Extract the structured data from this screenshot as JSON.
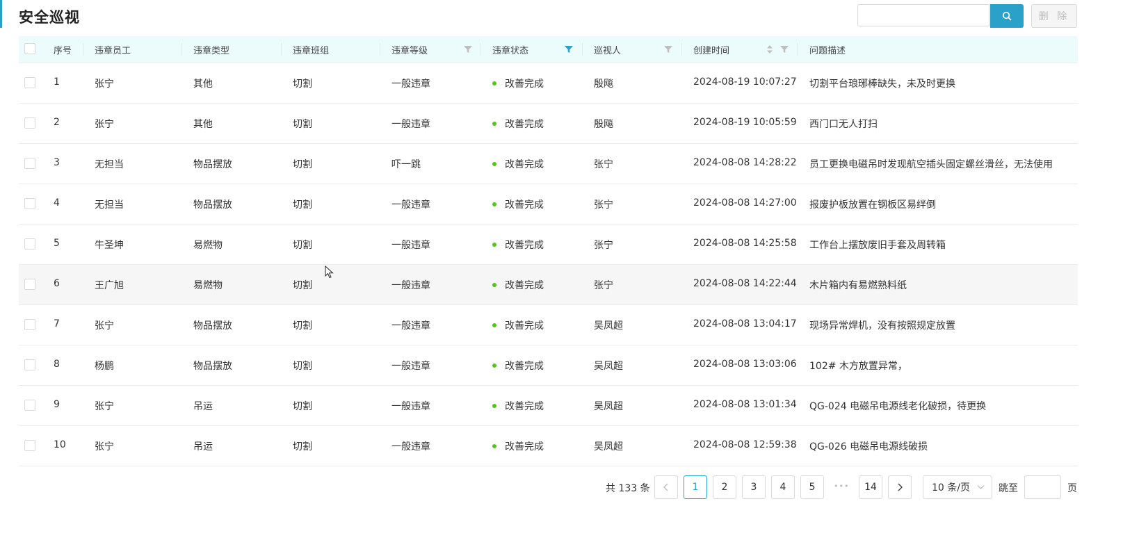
{
  "page": {
    "title": "安全巡视"
  },
  "toolbar": {
    "search_placeholder": "",
    "delete_label": "删 除"
  },
  "table": {
    "headers": {
      "index": "序号",
      "employee": "违章员工",
      "type": "违章类型",
      "team": "违章班组",
      "level": "违章等级",
      "status": "违章状态",
      "inspector": "巡视人",
      "created": "创建时间",
      "description": "问题描述"
    },
    "rows": [
      {
        "index": "1",
        "employee": "张宁",
        "type": "其他",
        "team": "切割",
        "level": "一般违章",
        "status": "改善完成",
        "inspector": "殷飚",
        "created": "2024-08-19 10:07:27",
        "description": "切割平台琅琊棒缺失，未及时更换"
      },
      {
        "index": "2",
        "employee": "张宁",
        "type": "其他",
        "team": "切割",
        "level": "一般违章",
        "status": "改善完成",
        "inspector": "殷飚",
        "created": "2024-08-19 10:05:59",
        "description": "西门口无人打扫"
      },
      {
        "index": "3",
        "employee": "无担当",
        "type": "物品摆放",
        "team": "切割",
        "level": "吓一跳",
        "status": "改善完成",
        "inspector": "张宁",
        "created": "2024-08-08 14:28:22",
        "description": "员工更换电磁吊时发现航空插头固定螺丝滑丝，无法使用"
      },
      {
        "index": "4",
        "employee": "无担当",
        "type": "物品摆放",
        "team": "切割",
        "level": "一般违章",
        "status": "改善完成",
        "inspector": "张宁",
        "created": "2024-08-08 14:27:00",
        "description": "报废护板放置在钢板区易绊倒"
      },
      {
        "index": "5",
        "employee": "牛圣坤",
        "type": "易燃物",
        "team": "切割",
        "level": "一般违章",
        "status": "改善完成",
        "inspector": "张宁",
        "created": "2024-08-08 14:25:58",
        "description": "工作台上摆放废旧手套及周转箱"
      },
      {
        "index": "6",
        "employee": "王广旭",
        "type": "易燃物",
        "team": "切割",
        "level": "一般违章",
        "status": "改善完成",
        "inspector": "张宁",
        "created": "2024-08-08 14:22:44",
        "description": "木片箱内有易燃熟料纸"
      },
      {
        "index": "7",
        "employee": "张宁",
        "type": "物品摆放",
        "team": "切割",
        "level": "一般违章",
        "status": "改善完成",
        "inspector": "吴凤超",
        "created": "2024-08-08 13:04:17",
        "description": "现场异常焊机，没有按照规定放置"
      },
      {
        "index": "8",
        "employee": "杨鹏",
        "type": "物品摆放",
        "team": "切割",
        "level": "一般违章",
        "status": "改善完成",
        "inspector": "吴凤超",
        "created": "2024-08-08 13:03:06",
        "description": "102# 木方放置异常，"
      },
      {
        "index": "9",
        "employee": "张宁",
        "type": "吊运",
        "team": "切割",
        "level": "一般违章",
        "status": "改善完成",
        "inspector": "吴凤超",
        "created": "2024-08-08 13:01:34",
        "description": "QG-024 电磁吊电源线老化破损，待更换"
      },
      {
        "index": "10",
        "employee": "张宁",
        "type": "吊运",
        "team": "切割",
        "level": "一般违章",
        "status": "改善完成",
        "inspector": "吴凤超",
        "created": "2024-08-08 12:59:38",
        "description": "QG-026 电磁吊电源线破损"
      }
    ]
  },
  "pagination": {
    "total_label": "共 133 条",
    "pages": [
      "1",
      "2",
      "3",
      "4",
      "5"
    ],
    "ellipsis": "•••",
    "last_page": "14",
    "current_page": "1",
    "page_size_label": "10 条/页",
    "jump_label": "跳至",
    "page_suffix": "页"
  },
  "colors": {
    "accent": "#2aa1c8",
    "status_dot": "#52c41a",
    "header_bg": "#ecfbfc"
  },
  "icons": {
    "search": "search-icon",
    "filter": "filter-icon",
    "sort": "sort-icon",
    "prev": "chevron-left-icon",
    "next": "chevron-right-icon",
    "dropdown": "chevron-down-icon"
  }
}
